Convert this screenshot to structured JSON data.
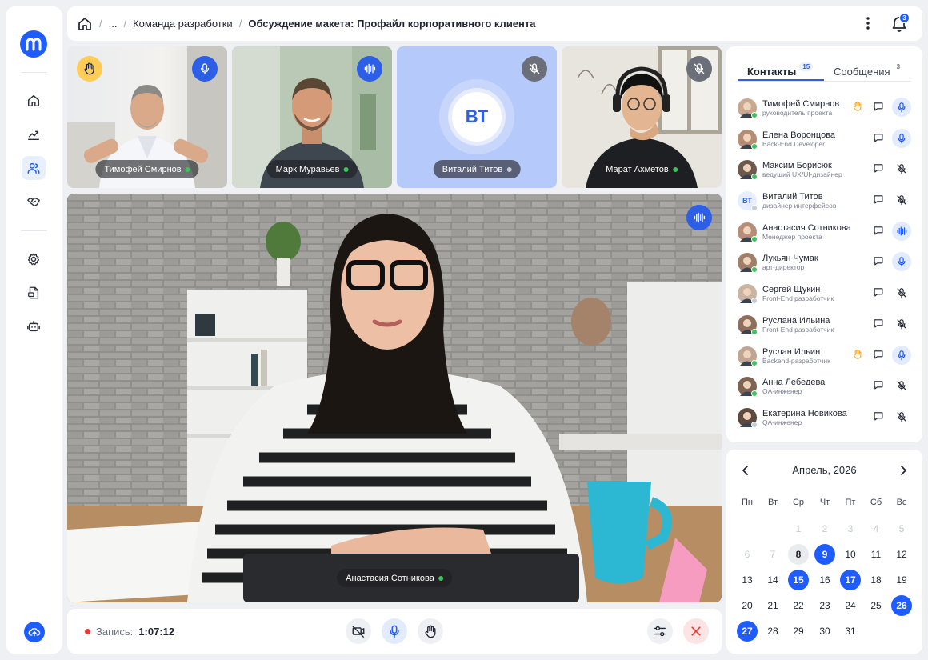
{
  "app": {
    "logo_letter": "m"
  },
  "colors": {
    "accent": "#1f5cff",
    "online": "#3cc45a",
    "offline": "#c7cbd3",
    "hand": "#ffcd57",
    "danger": "#e53935"
  },
  "sidebar": {
    "items": [
      {
        "name": "home",
        "icon": "home-icon",
        "active": false
      },
      {
        "name": "analytics",
        "icon": "chart-icon",
        "active": false
      },
      {
        "name": "people",
        "icon": "users-icon",
        "active": true
      },
      {
        "name": "deals",
        "icon": "handshake-icon",
        "active": false
      },
      {
        "name": "settings",
        "icon": "gear-icon",
        "active": false
      },
      {
        "name": "documents",
        "icon": "document-icon",
        "active": false
      },
      {
        "name": "bot",
        "icon": "robot-icon",
        "active": false
      }
    ],
    "upload_icon": "cloud-upload-icon"
  },
  "header": {
    "breadcrumb_ellipsis": "...",
    "breadcrumb_team": "Команда разработки",
    "title": "Обсуждение макета: Профайл корпоративного клиента",
    "notifications_count": "3"
  },
  "tiles": [
    {
      "name": "Тимофей Смирнов",
      "mic": "on",
      "hand": true,
      "online": true
    },
    {
      "name": "Марк Муравьев",
      "mic": "speaking",
      "hand": false,
      "online": true
    },
    {
      "name": "Виталий Титов",
      "initials": "ВТ",
      "mic": "off",
      "hand": false,
      "online": false
    },
    {
      "name": "Марат Ахметов",
      "mic": "off",
      "hand": false,
      "online": true
    }
  ],
  "main_video": {
    "name": "Анастасия Сотникова",
    "mic": "speaking",
    "online": true
  },
  "controls": {
    "record_label": "Запись:",
    "record_time": "1:07:12"
  },
  "contacts_panel": {
    "tab_contacts": "Контакты",
    "tab_contacts_count": "15",
    "tab_messages": "Сообщения",
    "tab_messages_count": "3",
    "contacts": [
      {
        "name": "Тимофей Смирнов",
        "role": "руководитель проекта",
        "online": true,
        "hand": true,
        "mic": "on"
      },
      {
        "name": "Елена Воронцова",
        "role": "Back-End Developer",
        "online": true,
        "hand": false,
        "mic": "on"
      },
      {
        "name": "Максим Борисюк",
        "role": "ведущий UX/UI-дизайнер",
        "online": true,
        "hand": false,
        "mic": "off"
      },
      {
        "name": "Виталий Титов",
        "role": "дизайнер интерфейсов",
        "initials": "ВТ",
        "online": false,
        "hand": false,
        "mic": "off"
      },
      {
        "name": "Анастасия Сотникова",
        "role": "Менеджер проекта",
        "online": true,
        "hand": false,
        "mic": "speaking"
      },
      {
        "name": "Лукьян Чумак",
        "role": "арт-директор",
        "online": true,
        "hand": false,
        "mic": "on"
      },
      {
        "name": "Сергей Щукин",
        "role": "Front-End разработчик",
        "online": false,
        "hand": false,
        "mic": "off"
      },
      {
        "name": "Руслана Ильина",
        "role": "Front-End разработчик",
        "online": true,
        "hand": false,
        "mic": "off"
      },
      {
        "name": "Руслан Ильин",
        "role": "Backend-разработчик",
        "online": true,
        "hand": true,
        "mic": "on"
      },
      {
        "name": "Анна Лебедева",
        "role": "QA-инженер",
        "online": true,
        "hand": false,
        "mic": "off"
      },
      {
        "name": "Екатерина Новикова",
        "role": "QA-инженер",
        "online": false,
        "hand": false,
        "mic": "off"
      }
    ]
  },
  "calendar": {
    "title": "Апрель, 2026",
    "weekdays": [
      "Пн",
      "Вт",
      "Ср",
      "Чт",
      "Пт",
      "Сб",
      "Вс"
    ],
    "weeks": [
      [
        null,
        null,
        "1",
        "2",
        "3",
        "4",
        "5"
      ],
      [
        "6",
        "7",
        "8",
        "9",
        "10",
        "11",
        "12"
      ],
      [
        "13",
        "14",
        "15",
        "16",
        "17",
        "18",
        "19"
      ],
      [
        "20",
        "21",
        "22",
        "23",
        "24",
        "25",
        "26"
      ],
      [
        "27",
        "28",
        "29",
        "30",
        "31",
        null,
        null
      ]
    ],
    "muted_days": [
      "1",
      "2",
      "3",
      "4",
      "5",
      "6",
      "7"
    ],
    "today": "8",
    "marked_days": [
      "9",
      "15",
      "17",
      "26",
      "27"
    ]
  }
}
